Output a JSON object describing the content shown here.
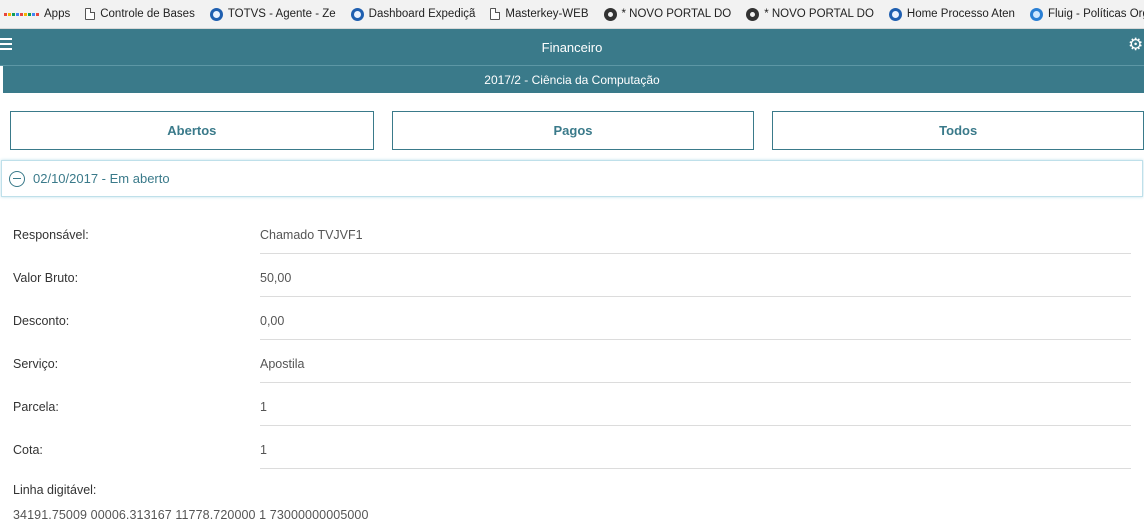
{
  "bookmarks": [
    {
      "label": "Apps",
      "icon": "apps-grid-icon"
    },
    {
      "label": "Controle de Bases",
      "icon": "document-icon"
    },
    {
      "label": "TOTVS - Agente - Ze",
      "icon": "globe-icon"
    },
    {
      "label": "Dashboard Expediçã",
      "icon": "globe-icon"
    },
    {
      "label": "Masterkey-WEB",
      "icon": "document-icon"
    },
    {
      "label": "* NOVO PORTAL DO",
      "icon": "portal-icon"
    },
    {
      "label": "* NOVO PORTAL DO",
      "icon": "portal-icon"
    },
    {
      "label": "Home Processo Aten",
      "icon": "globe-icon"
    },
    {
      "label": "Fluig - Políticas Orga",
      "icon": "fluig-icon"
    }
  ],
  "header": {
    "title": "Financeiro",
    "menu_icon": "hamburger-icon",
    "settings_icon": "gear-icon"
  },
  "period": {
    "label": "2017/2 - Ciência da Computação"
  },
  "tabs": [
    {
      "label": "Abertos"
    },
    {
      "label": "Pagos"
    },
    {
      "label": "Todos"
    }
  ],
  "accordion": {
    "title": "02/10/2017 - Em aberto",
    "icon": "minus-circle-icon"
  },
  "details": [
    {
      "label": "Responsável:",
      "value": "Chamado TVJVF1"
    },
    {
      "label": "Valor Bruto:",
      "value": "50,00"
    },
    {
      "label": "Desconto:",
      "value": "0,00"
    },
    {
      "label": "Serviço:",
      "value": "Apostila"
    },
    {
      "label": "Parcela:",
      "value": "1"
    },
    {
      "label": "Cota:",
      "value": "1"
    }
  ],
  "linha_digitavel": {
    "label": "Linha digitável:",
    "value": "34191.75009 00006.313167 11778.720000 1 73000000005000"
  },
  "colors": {
    "primary": "#3a7a8a",
    "accordion_border": "#bfe0ea"
  }
}
